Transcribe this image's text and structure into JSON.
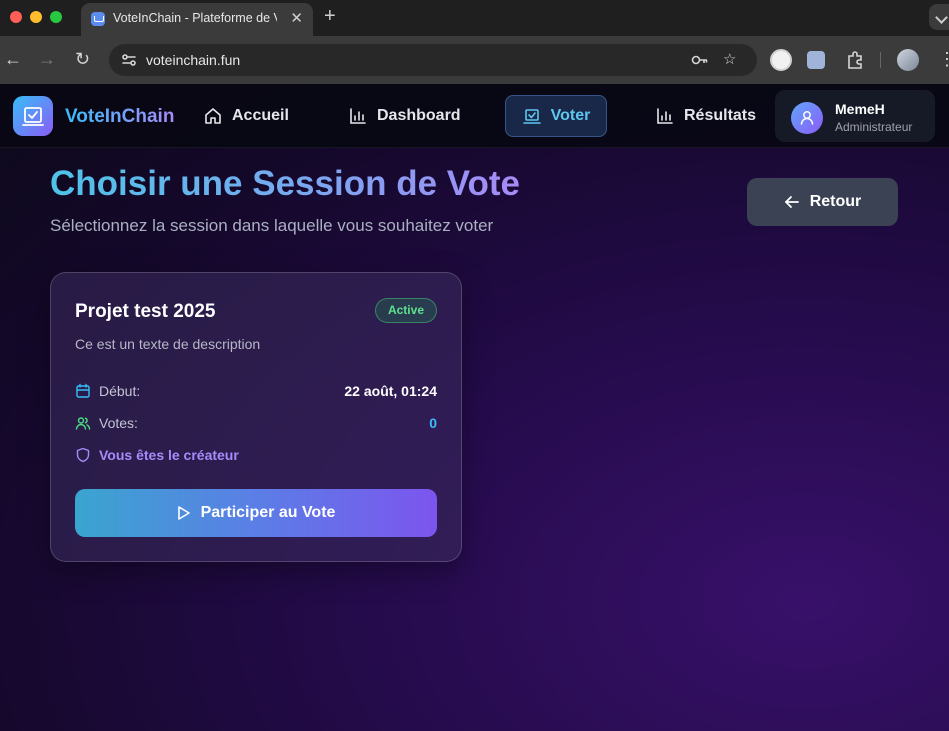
{
  "browser": {
    "tab_title": "VoteInChain - Plateforme de Vote",
    "url": "voteinchain.fun"
  },
  "app": {
    "brand": "VoteInChain",
    "nav": [
      {
        "label": "Accueil",
        "icon": "home-icon"
      },
      {
        "label": "Dashboard",
        "icon": "bar-chart-icon"
      },
      {
        "label": "Voter",
        "icon": "vote-box-icon",
        "active": true
      },
      {
        "label": "Résultats",
        "icon": "bar-chart-icon"
      }
    ],
    "user": {
      "name": "MemeH",
      "role": "Administrateur"
    }
  },
  "page": {
    "title": "Choisir une Session de Vote",
    "subtitle": "Sélectionnez la session dans laquelle vous souhaitez voter",
    "back_label": "Retour"
  },
  "session": {
    "title": "Projet test 2025",
    "status": "Active",
    "description": "Ce est un texte de description",
    "start_label": "Début:",
    "start_value": "22 août, 01:24",
    "votes_label": "Votes:",
    "votes_value": "0",
    "creator_note": "Vous êtes le créateur",
    "participate_label": "Participer au Vote"
  },
  "colors": {
    "accent_cyan": "#38bdf8",
    "accent_violet": "#8b5cf6",
    "status_green": "#5ee08e"
  }
}
